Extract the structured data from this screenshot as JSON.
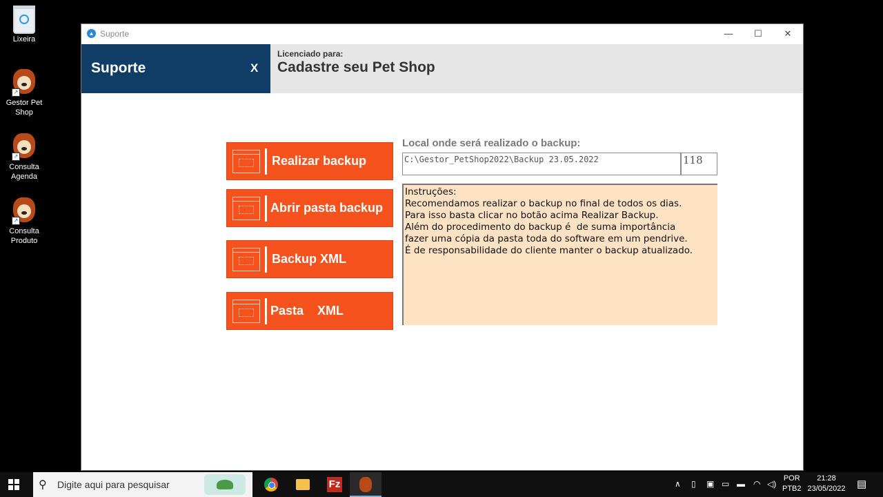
{
  "desktop": {
    "icons": [
      {
        "label": "Lixeira",
        "icon": "recycle-bin-icon"
      },
      {
        "label": "Gestor Pet Shop",
        "icon": "pet-shop-icon"
      },
      {
        "label": "Consulta Agenda",
        "icon": "pet-shop-icon"
      },
      {
        "label": "Consulta Produto",
        "icon": "pet-shop-icon"
      }
    ]
  },
  "window": {
    "title": "Suporte",
    "controls": {
      "minimize": "—",
      "maximize": "☐",
      "close": "✕"
    }
  },
  "header": {
    "section_title": "Suporte",
    "close_label": "X",
    "licensed_label": "Licenciado para:",
    "licensed_name": "Cadastre seu Pet Shop"
  },
  "actions": [
    {
      "label": "Realizar backup"
    },
    {
      "label": "Abrir pasta backup"
    },
    {
      "label": "Backup XML"
    },
    {
      "label": "Pasta    XML"
    }
  ],
  "backup": {
    "location_label": "Local onde será  realizado o backup:",
    "path_value": "C:\\Gestor_PetShop2022\\Backup 23.05.2022",
    "count_value": "118"
  },
  "instructions": {
    "lines": [
      "Instruções:",
      "",
      "Recomendamos realizar o backup no final de todos os dias.",
      "Para isso basta clicar no botão acima Realizar Backup.",
      "Além do procedimento do backup é  de suma importância",
      "fazer uma cópia da pasta toda do software em um pendrive.",
      "É de responsabilidade do cliente manter o backup atualizado."
    ],
    "background": "#fde2c4"
  },
  "taskbar": {
    "search_placeholder": "Digite aqui para pesquisar",
    "apps": [
      "chrome-icon",
      "file-explorer-icon",
      "filezilla-icon",
      "pet-shop-icon"
    ],
    "filezilla_glyph": "Fz",
    "language": "POR",
    "layout": "PTB2",
    "time": "21:28",
    "date": "23/05/2022"
  },
  "colors": {
    "header_blue": "#0f3d66",
    "button_orange": "#f6521e",
    "header_gray": "#e6e6e6"
  }
}
